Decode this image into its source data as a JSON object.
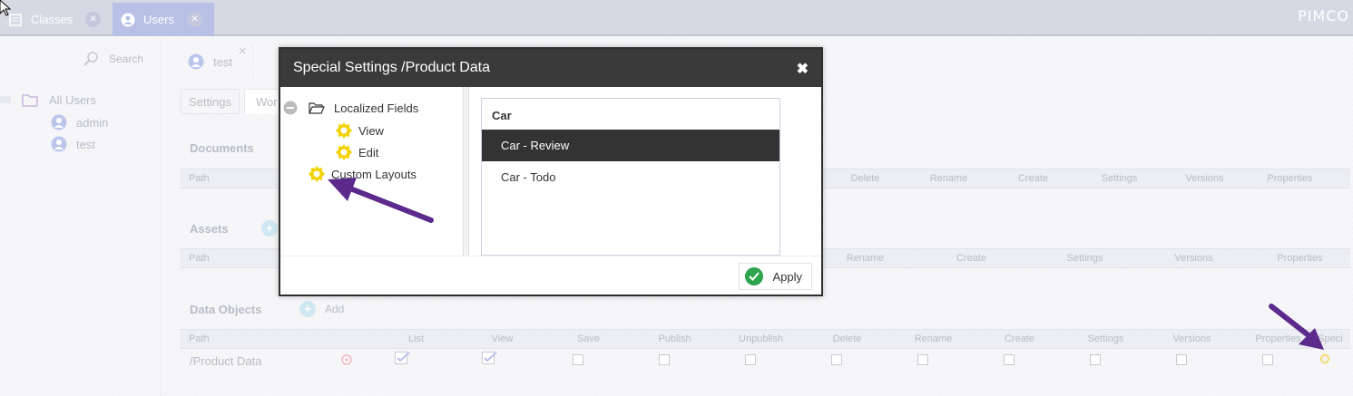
{
  "topbar": {
    "tabs": [
      {
        "label": "Classes"
      },
      {
        "label": "Users"
      }
    ],
    "logo": "PIMCO"
  },
  "left_panel": {
    "search_label": "Search",
    "tree": {
      "root_label": "All Users",
      "users": [
        "admin",
        "test"
      ]
    }
  },
  "editor": {
    "tab_label": "test",
    "subtabs": [
      "Settings",
      "Wor"
    ],
    "sections": {
      "documents": "Documents",
      "assets": "Assets",
      "data_objects": "Data Objects"
    },
    "add_label": "Add",
    "path_label": "Path",
    "documents_columns": [
      "Delete",
      "Rename",
      "Create",
      "Settings",
      "Versions",
      "Properties"
    ],
    "assets_columns": [
      "Rename",
      "Create",
      "Settings",
      "Versions",
      "Properties"
    ],
    "data_objects_columns": [
      "List",
      "View",
      "Save",
      "Publish",
      "Unpublish",
      "Delete",
      "Rename",
      "Create",
      "Settings",
      "Versions",
      "Properties",
      "Speci"
    ],
    "row": {
      "path": "/Product Data"
    }
  },
  "modal": {
    "title": "Special Settings /Product Data",
    "tree": {
      "root": "Localized Fields",
      "children": [
        "View",
        "Edit"
      ],
      "sibling": "Custom Layouts"
    },
    "layouts": {
      "header": "Car",
      "items": [
        "Car - Review",
        "Car - Todo"
      ],
      "selected_index": 0
    },
    "apply_label": "Apply"
  },
  "colors": {
    "annotation_arrow": "#5b2a8c",
    "gear": "#f2d300",
    "header_bg": "#3a3a3a",
    "selected_bg": "#333333",
    "apply_check": "#2ea44f"
  }
}
